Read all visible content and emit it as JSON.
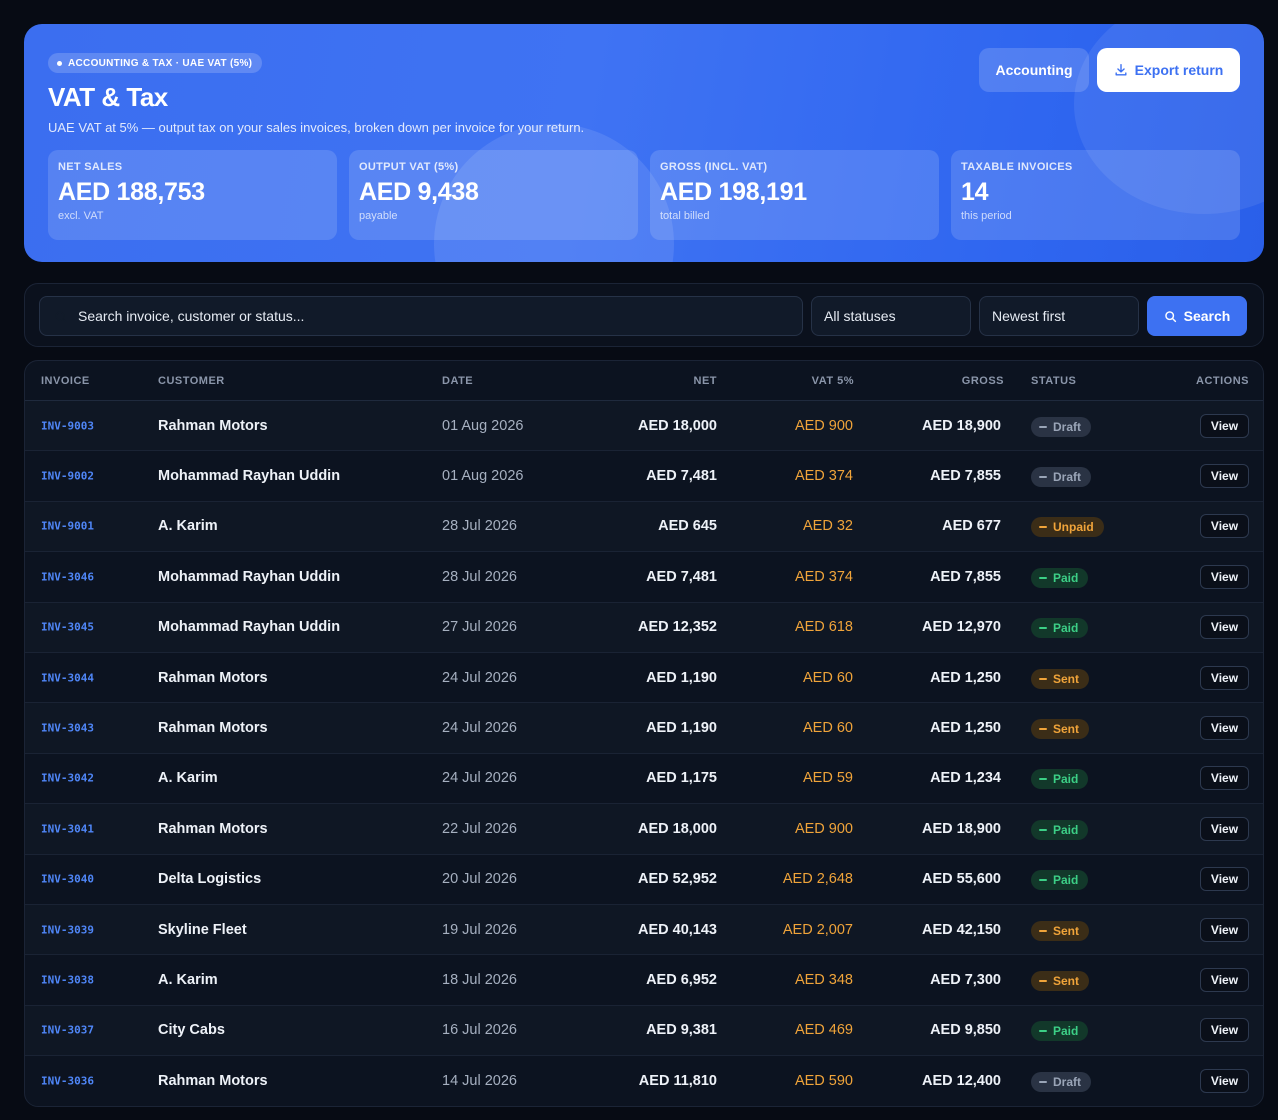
{
  "hero": {
    "chip": "ACCOUNTING & TAX · UAE VAT (5%)",
    "title": "VAT & Tax",
    "subtitle": "UAE VAT at 5% — output tax on your sales invoices, broken down per invoice for your return.",
    "accounting_label": "Accounting",
    "export_label": "Export return",
    "stats": [
      {
        "label": "NET SALES",
        "value": "AED 188,753",
        "note": "excl. VAT"
      },
      {
        "label": "OUTPUT VAT (5%)",
        "value": "AED 9,438",
        "note": "payable"
      },
      {
        "label": "GROSS (INCL. VAT)",
        "value": "AED 198,191",
        "note": "total billed"
      },
      {
        "label": "TAXABLE INVOICES",
        "value": "14",
        "note": "this period"
      }
    ]
  },
  "filters": {
    "search_placeholder": "Search invoice, customer or status...",
    "status_value": "All statuses",
    "sort_value": "Newest first",
    "search_button": "Search"
  },
  "table": {
    "headers": [
      "INVOICE",
      "CUSTOMER",
      "DATE",
      "NET",
      "VAT 5%",
      "GROSS",
      "STATUS",
      "ACTIONS"
    ],
    "rows": [
      {
        "invoice": "INV-9003",
        "customer": "Rahman Motors",
        "date": "01 Aug 2026",
        "net": "AED 18,000",
        "vat": "AED 900",
        "gross": "AED 18,900",
        "status": "Draft",
        "action": "View"
      },
      {
        "invoice": "INV-9002",
        "customer": "Mohammad Rayhan Uddin",
        "date": "01 Aug 2026",
        "net": "AED 7,481",
        "vat": "AED 374",
        "gross": "AED 7,855",
        "status": "Draft",
        "action": "View"
      },
      {
        "invoice": "INV-9001",
        "customer": "A. Karim",
        "date": "28 Jul 2026",
        "net": "AED 645",
        "vat": "AED 32",
        "gross": "AED 677",
        "status": "Unpaid",
        "action": "View"
      },
      {
        "invoice": "INV-3046",
        "customer": "Mohammad Rayhan Uddin",
        "date": "28 Jul 2026",
        "net": "AED 7,481",
        "vat": "AED 374",
        "gross": "AED 7,855",
        "status": "Paid",
        "action": "View"
      },
      {
        "invoice": "INV-3045",
        "customer": "Mohammad Rayhan Uddin",
        "date": "27 Jul 2026",
        "net": "AED 12,352",
        "vat": "AED 618",
        "gross": "AED 12,970",
        "status": "Paid",
        "action": "View"
      },
      {
        "invoice": "INV-3044",
        "customer": "Rahman Motors",
        "date": "24 Jul 2026",
        "net": "AED 1,190",
        "vat": "AED 60",
        "gross": "AED 1,250",
        "status": "Sent",
        "action": "View"
      },
      {
        "invoice": "INV-3043",
        "customer": "Rahman Motors",
        "date": "24 Jul 2026",
        "net": "AED 1,190",
        "vat": "AED 60",
        "gross": "AED 1,250",
        "status": "Sent",
        "action": "View"
      },
      {
        "invoice": "INV-3042",
        "customer": "A. Karim",
        "date": "24 Jul 2026",
        "net": "AED 1,175",
        "vat": "AED 59",
        "gross": "AED 1,234",
        "status": "Paid",
        "action": "View"
      },
      {
        "invoice": "INV-3041",
        "customer": "Rahman Motors",
        "date": "22 Jul 2026",
        "net": "AED 18,000",
        "vat": "AED 900",
        "gross": "AED 18,900",
        "status": "Paid",
        "action": "View"
      },
      {
        "invoice": "INV-3040",
        "customer": "Delta Logistics",
        "date": "20 Jul 2026",
        "net": "AED 52,952",
        "vat": "AED 2,648",
        "gross": "AED 55,600",
        "status": "Paid",
        "action": "View"
      },
      {
        "invoice": "INV-3039",
        "customer": "Skyline Fleet",
        "date": "19 Jul 2026",
        "net": "AED 40,143",
        "vat": "AED 2,007",
        "gross": "AED 42,150",
        "status": "Sent",
        "action": "View"
      },
      {
        "invoice": "INV-3038",
        "customer": "A. Karim",
        "date": "18 Jul 2026",
        "net": "AED 6,952",
        "vat": "AED 348",
        "gross": "AED 7,300",
        "status": "Sent",
        "action": "View"
      },
      {
        "invoice": "INV-3037",
        "customer": "City Cabs",
        "date": "16 Jul 2026",
        "net": "AED 9,381",
        "vat": "AED 469",
        "gross": "AED 9,850",
        "status": "Paid",
        "action": "View"
      },
      {
        "invoice": "INV-3036",
        "customer": "Rahman Motors",
        "date": "14 Jul 2026",
        "net": "AED 11,810",
        "vat": "AED 590",
        "gross": "AED 12,400",
        "status": "Draft",
        "action": "View"
      }
    ]
  }
}
